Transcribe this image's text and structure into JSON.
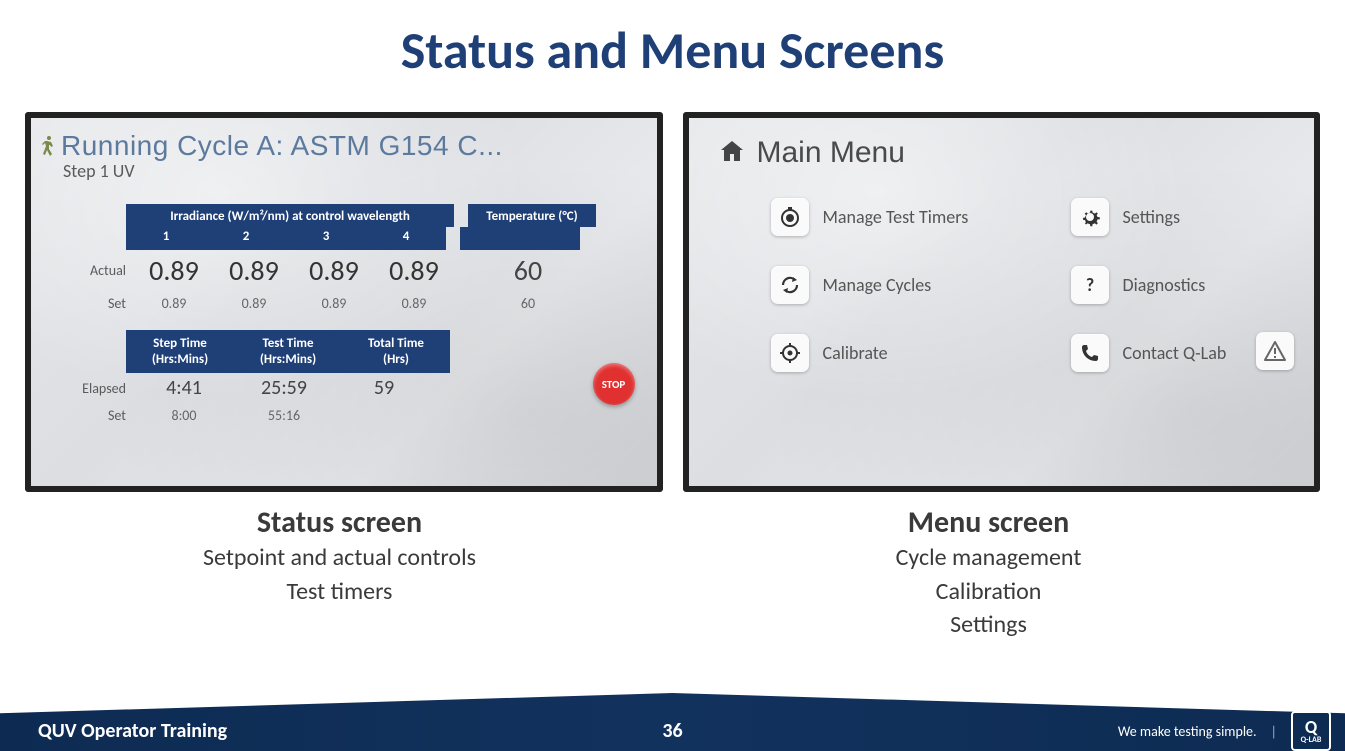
{
  "slide": {
    "title": "Status and Menu Screens"
  },
  "status_screen": {
    "cycle_title": "Running Cycle A: ASTM G154 C...",
    "step_subtitle": "Step 1 UV",
    "irradiance_header": "Irradiance (W/m²/nm) at control wavelength",
    "temperature_header": "Temperature (°C)",
    "columns": [
      "1",
      "2",
      "3",
      "4"
    ],
    "row_actual_label": "Actual",
    "row_set_label": "Set",
    "actual_values": [
      "0.89",
      "0.89",
      "0.89",
      "0.89"
    ],
    "actual_temp": "60",
    "set_values": [
      "0.89",
      "0.89",
      "0.89",
      "0.89"
    ],
    "set_temp": "60",
    "time_headers": {
      "step": "Step Time",
      "step_sub": "(Hrs:Mins)",
      "test": "Test Time",
      "test_sub": "(Hrs:Mins)",
      "total": "Total Time",
      "total_sub": "(Hrs)"
    },
    "row_elapsed_label": "Elapsed",
    "row2_set_label": "Set",
    "elapsed": {
      "step": "4:41",
      "test": "25:59",
      "total": "59"
    },
    "set_times": {
      "step": "8:00",
      "test": "55:16",
      "total": ""
    },
    "stop_label": "STOP"
  },
  "menu_screen": {
    "title": "Main Menu",
    "items_left": [
      {
        "label": "Manage Test Timers",
        "name": "manage-test-timers"
      },
      {
        "label": "Manage Cycles",
        "name": "manage-cycles"
      },
      {
        "label": "Calibrate",
        "name": "calibrate"
      }
    ],
    "items_right": [
      {
        "label": "Settings",
        "name": "settings"
      },
      {
        "label": "Diagnostics",
        "name": "diagnostics"
      },
      {
        "label": "Contact Q-Lab",
        "name": "contact-qlab"
      }
    ]
  },
  "captions": {
    "status": {
      "title": "Status screen",
      "line1": "Setpoint and actual controls",
      "line2": "Test timers"
    },
    "menu": {
      "title": "Menu screen",
      "line1": "Cycle management",
      "line2": "Calibration",
      "line3": "Settings"
    }
  },
  "footer": {
    "left": "QUV Operator Training",
    "page": "36",
    "tagline": "We make testing simple.",
    "brand": "Q-LAB",
    "brand_q": "Q"
  }
}
